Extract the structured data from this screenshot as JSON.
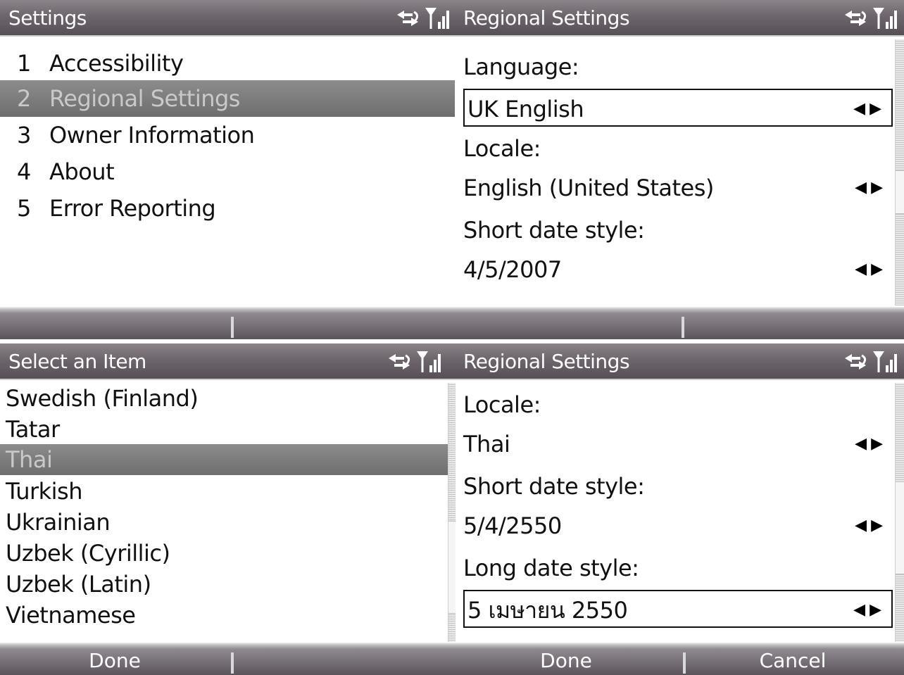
{
  "top_left": {
    "title": "Settings",
    "menu": [
      {
        "num": "1",
        "label": "Accessibility"
      },
      {
        "num": "2",
        "label": "Regional Settings"
      },
      {
        "num": "3",
        "label": "Owner Information"
      },
      {
        "num": "4",
        "label": "About"
      },
      {
        "num": "5",
        "label": "Error Reporting"
      }
    ],
    "selected_index": 1
  },
  "top_right": {
    "title": "Regional Settings",
    "fields": [
      {
        "label": "Language:",
        "value": "UK English"
      },
      {
        "label": "Locale:",
        "value": "English (United States)"
      },
      {
        "label": "Short date style:",
        "value": "4/5/2007"
      }
    ]
  },
  "bottom_left": {
    "title": "Select an Item",
    "items": [
      "Swedish (Finland)",
      "Tatar",
      "Thai",
      "Turkish",
      "Ukrainian",
      "Uzbek (Cyrillic)",
      "Uzbek (Latin)",
      "Vietnamese"
    ],
    "selected_index": 2,
    "softkey_left": "Done"
  },
  "bottom_right": {
    "title": "Regional Settings",
    "fields": [
      {
        "label": "Locale:",
        "value": "Thai"
      },
      {
        "label": "Short date style:",
        "value": "5/4/2550"
      },
      {
        "label": "Long date style:",
        "value": "5 เมษายน 2550"
      }
    ],
    "softkey_left": "Done",
    "softkey_right": "Cancel"
  },
  "icons": {
    "sync": "sync-arrows-icon",
    "signal": "signal-strength-icon",
    "picker": "left-right-arrows-icon"
  },
  "arrows_glyph": "◀▶",
  "colors": {
    "titlebar": "#6d676d",
    "selection": "#7d7d7d",
    "selected_text": "#c9c9c9",
    "softkey_text": "#ffffff"
  }
}
